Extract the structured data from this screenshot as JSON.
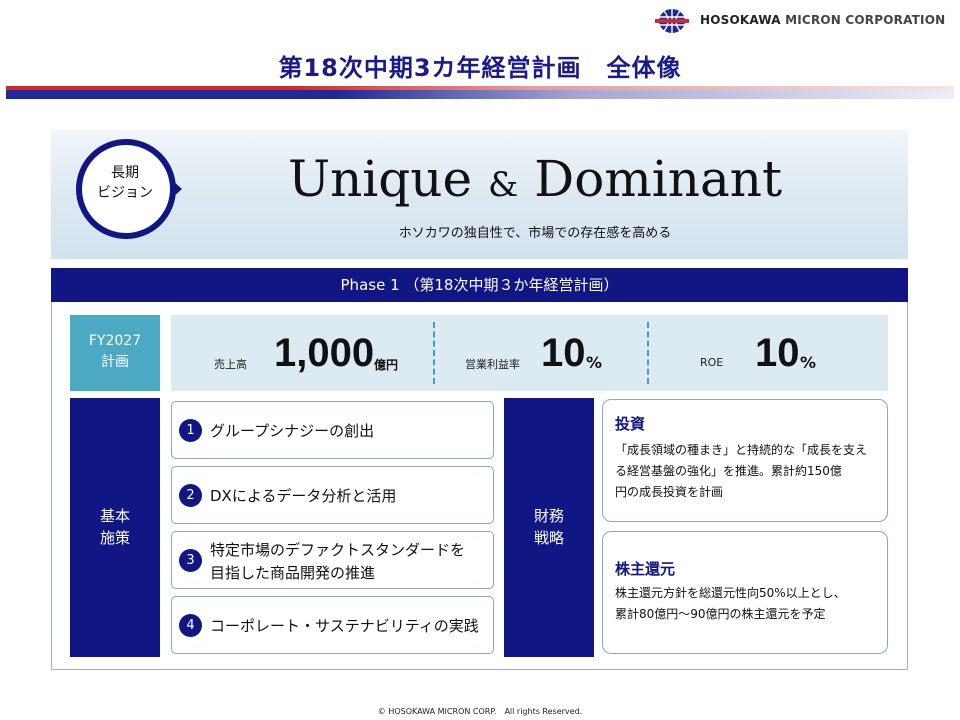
{
  "header": {
    "company_bold": "HOSOKAWA",
    "company_rest": "MICRON CORPORATION",
    "logo_icon": "globe-logo-icon",
    "title": "第18次中期3カ年経営計画　全体像"
  },
  "vision": {
    "badge_line1": "長期",
    "badge_line2": "ビジョン",
    "main_word1": "Unique",
    "main_amp": "&",
    "main_word2": "Dominant",
    "subtitle": "ホソカワの独自性で、市場での存在感を高める"
  },
  "phase": {
    "header": "Phase 1 （第18次中期３か年経営計画）",
    "plan_label_line1": "FY2027",
    "plan_label_line2": "計画",
    "kpis": [
      {
        "label": "売上高",
        "value": "1,000",
        "unit": "億円"
      },
      {
        "label": "営業利益率",
        "value": "10",
        "unit": "%"
      },
      {
        "label": "ROE",
        "value": "10",
        "unit": "%"
      }
    ]
  },
  "basic_policy": {
    "label_line1": "基本",
    "label_line2": "施策",
    "items": [
      {
        "num": "1",
        "line1": "グループシナジーの創出",
        "line2": ""
      },
      {
        "num": "2",
        "line1": "DXによるデータ分析と活用",
        "line2": ""
      },
      {
        "num": "3",
        "line1": "特定市場のデファクトスタンダードを",
        "line2": "目指した商品開発の推進"
      },
      {
        "num": "4",
        "line1": "コーポレート・サステナビリティの実践",
        "line2": ""
      }
    ]
  },
  "finance": {
    "label_line1": "財務",
    "label_line2": "戦略",
    "investment": {
      "title": "投資",
      "line1": "「成長領域の種まき」と持続的な「成長を支え",
      "line2": "る経営基盤の強化」を推進。累計約150億",
      "line3": "円の成長投資を計画"
    },
    "returns": {
      "title": "株主還元",
      "line1": "株主還元方針を総還元性向50%以上とし、",
      "line2": "累計80億円～90億円の株主還元を予定"
    }
  },
  "footer": {
    "copyright": "© HOSOKAWA MICRON CORP.　All rights Reserved."
  },
  "colors": {
    "navy": "#101683",
    "teal": "#4ba9c4",
    "light_blue": "#dceaf1",
    "red": "#d3282b"
  }
}
